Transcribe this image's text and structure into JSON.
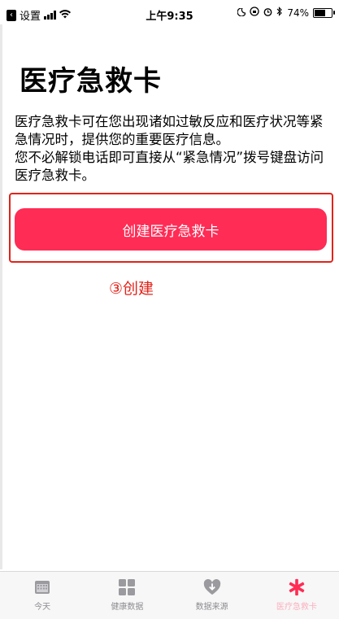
{
  "status_bar": {
    "back_label": "设置",
    "time": "上午9:35",
    "battery": "74%",
    "battery_level": 0.74
  },
  "title": "医疗急救卡",
  "description": {
    "line1": "医疗急救卡可在您出现诸如过敏反应和医疗状况等紧急情况时，提供您的重要医疗信息。",
    "line2": "您不必解锁电话即可直接从“紧急情况”拨号键盘访问医疗急救卡。"
  },
  "button": {
    "label": "创建医疗急救卡"
  },
  "annotation": {
    "text": "③创建"
  },
  "colors": {
    "accent": "#ff2c55",
    "annotation": "#e2231a",
    "tab_inactive": "#8e8e93"
  },
  "tabs": [
    {
      "label": "今天",
      "icon": "calendar-icon"
    },
    {
      "label": "健康数据",
      "icon": "grid-icon"
    },
    {
      "label": "数据来源",
      "icon": "download-heart-icon"
    },
    {
      "label": "医疗急救卡",
      "icon": "medical-asterisk-icon"
    }
  ]
}
